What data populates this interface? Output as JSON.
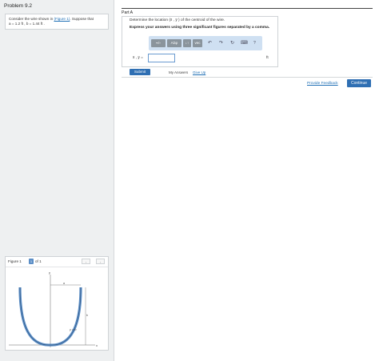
{
  "problem": {
    "title": "Problem 9.2",
    "text_prefix": "Consider the wire shown in ",
    "figure_link": "(Figure 1)",
    "text_suffix": ". Suppose that",
    "given": "a = 1.2  ft , b = 1.44  ft ."
  },
  "figure_panel": {
    "label": "Figure 1",
    "page_value": "1",
    "of_text": "of 1",
    "prev_glyph": "‹",
    "next_glyph": "›",
    "curve_label": "y = x²",
    "axis_x": "x",
    "axis_y": "y",
    "dim_a": "a",
    "dim_b": "b"
  },
  "part": {
    "label": "Part A",
    "question": "Determine the location (x̄ , ȳ ) of the centroid of the wire.",
    "instruction": "Express your answers using three significant figures separated by a comma."
  },
  "toolbar": {
    "btn1": "▪√▫",
    "btn2": "ΑΣφ",
    "btn3": "↓↑",
    "btn4": "vec",
    "undo": "↶",
    "redo": "↷",
    "reset": "↻",
    "keyboard": "⌨",
    "help": "?"
  },
  "answer": {
    "prefix": "x̄ , ȳ =",
    "value": "",
    "unit": "ft"
  },
  "actions": {
    "submit": "Submit",
    "my_answers": "My Answers",
    "give_up": "Give Up",
    "feedback": "Provide Feedback",
    "continue": "Continue"
  },
  "colors": {
    "accent": "#2f6fb3",
    "toolbar": "#cfe0f2",
    "wire": "#5b8ec6"
  }
}
